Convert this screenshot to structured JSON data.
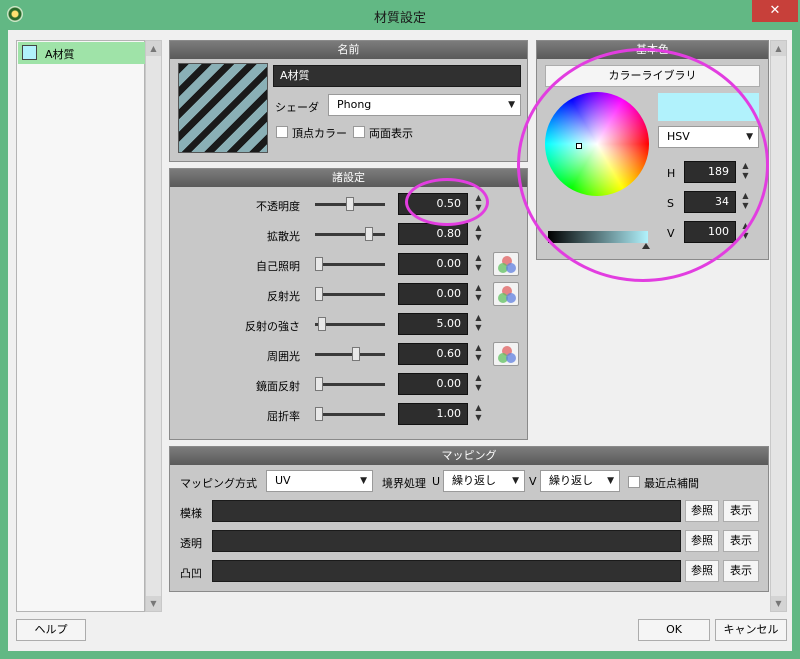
{
  "window": {
    "title": "材質設定",
    "close": "✕"
  },
  "materials": [
    {
      "name": "A材質",
      "color": "#b1f2fc"
    }
  ],
  "name_panel": {
    "header": "名前",
    "name_value": "A材質",
    "shader_label": "シェーダ",
    "shader_value": "Phong",
    "vertex_color": "頂点カラー",
    "double_side": "両面表示"
  },
  "settings_panel": {
    "header": "諸設定",
    "rows": [
      {
        "label": "不透明度",
        "value": "0.50",
        "slider": 0.5,
        "mix": false
      },
      {
        "label": "拡散光",
        "value": "0.80",
        "slider": 0.8,
        "mix": false
      },
      {
        "label": "自己照明",
        "value": "0.00",
        "slider": 0.0,
        "mix": true
      },
      {
        "label": "反射光",
        "value": "0.00",
        "slider": 0.0,
        "mix": true
      },
      {
        "label": "反射の強さ",
        "value": "5.00",
        "slider": 0.05,
        "mix": false
      },
      {
        "label": "周囲光",
        "value": "0.60",
        "slider": 0.6,
        "mix": true
      },
      {
        "label": "鏡面反射",
        "value": "0.00",
        "slider": 0.0,
        "mix": false
      },
      {
        "label": "屈折率",
        "value": "1.00",
        "slider": 0.0,
        "mix": false
      }
    ]
  },
  "color_panel": {
    "header": "基本色",
    "library_button": "カラーライブラリ",
    "swatch": "#b1f2fc",
    "mode": "HSV",
    "h_label": "H",
    "h_value": "189",
    "s_label": "S",
    "s_value": "34",
    "v_label": "V",
    "v_value": "100"
  },
  "mapping_panel": {
    "header": "マッピング",
    "method_label": "マッピング方式",
    "method_value": "UV",
    "boundary_label": "境界処理",
    "u_label": "U",
    "u_value": "繰り返し",
    "v_label": "V",
    "v_value": "繰り返し",
    "nearest": "最近点補間",
    "rows": [
      {
        "label": "模様",
        "ref": "参照",
        "show": "表示"
      },
      {
        "label": "透明",
        "ref": "参照",
        "show": "表示"
      },
      {
        "label": "凸凹",
        "ref": "参照",
        "show": "表示"
      }
    ]
  },
  "footer": {
    "help": "ヘルプ",
    "ok": "OK",
    "cancel": "キャンセル"
  }
}
